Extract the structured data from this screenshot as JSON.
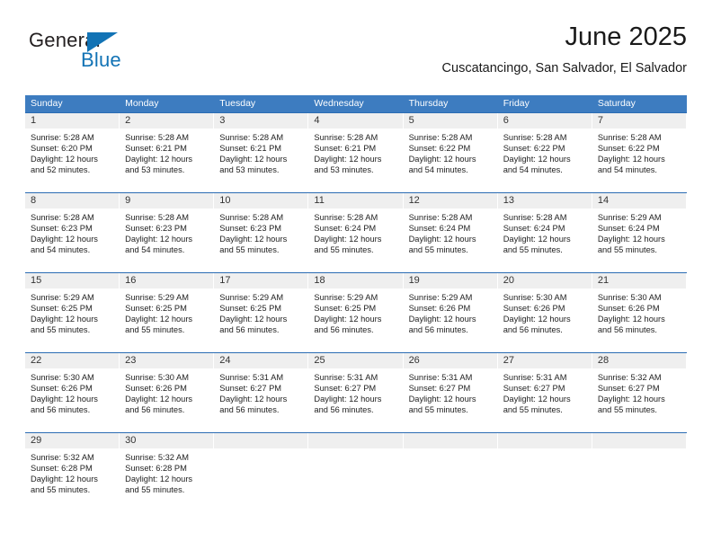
{
  "brand": {
    "name_part1": "General",
    "name_part2": "Blue",
    "flag_icon": "blue-triangle-flag-icon",
    "accent_color": "#1273b5"
  },
  "header": {
    "title": "June 2025",
    "subtitle": "Cuscatancingo, San Salvador, El Salvador"
  },
  "theme": {
    "header_blue": "#3d7cc0",
    "row_border_blue": "#2b6cb3",
    "daynum_band_gray": "#efefef"
  },
  "weekdays": [
    "Sunday",
    "Monday",
    "Tuesday",
    "Wednesday",
    "Thursday",
    "Friday",
    "Saturday"
  ],
  "weeks": [
    [
      {
        "day": "1",
        "sunrise": "Sunrise: 5:28 AM",
        "sunset": "Sunset: 6:20 PM",
        "daylight1": "Daylight: 12 hours",
        "daylight2": "and 52 minutes."
      },
      {
        "day": "2",
        "sunrise": "Sunrise: 5:28 AM",
        "sunset": "Sunset: 6:21 PM",
        "daylight1": "Daylight: 12 hours",
        "daylight2": "and 53 minutes."
      },
      {
        "day": "3",
        "sunrise": "Sunrise: 5:28 AM",
        "sunset": "Sunset: 6:21 PM",
        "daylight1": "Daylight: 12 hours",
        "daylight2": "and 53 minutes."
      },
      {
        "day": "4",
        "sunrise": "Sunrise: 5:28 AM",
        "sunset": "Sunset: 6:21 PM",
        "daylight1": "Daylight: 12 hours",
        "daylight2": "and 53 minutes."
      },
      {
        "day": "5",
        "sunrise": "Sunrise: 5:28 AM",
        "sunset": "Sunset: 6:22 PM",
        "daylight1": "Daylight: 12 hours",
        "daylight2": "and 54 minutes."
      },
      {
        "day": "6",
        "sunrise": "Sunrise: 5:28 AM",
        "sunset": "Sunset: 6:22 PM",
        "daylight1": "Daylight: 12 hours",
        "daylight2": "and 54 minutes."
      },
      {
        "day": "7",
        "sunrise": "Sunrise: 5:28 AM",
        "sunset": "Sunset: 6:22 PM",
        "daylight1": "Daylight: 12 hours",
        "daylight2": "and 54 minutes."
      }
    ],
    [
      {
        "day": "8",
        "sunrise": "Sunrise: 5:28 AM",
        "sunset": "Sunset: 6:23 PM",
        "daylight1": "Daylight: 12 hours",
        "daylight2": "and 54 minutes."
      },
      {
        "day": "9",
        "sunrise": "Sunrise: 5:28 AM",
        "sunset": "Sunset: 6:23 PM",
        "daylight1": "Daylight: 12 hours",
        "daylight2": "and 54 minutes."
      },
      {
        "day": "10",
        "sunrise": "Sunrise: 5:28 AM",
        "sunset": "Sunset: 6:23 PM",
        "daylight1": "Daylight: 12 hours",
        "daylight2": "and 55 minutes."
      },
      {
        "day": "11",
        "sunrise": "Sunrise: 5:28 AM",
        "sunset": "Sunset: 6:24 PM",
        "daylight1": "Daylight: 12 hours",
        "daylight2": "and 55 minutes."
      },
      {
        "day": "12",
        "sunrise": "Sunrise: 5:28 AM",
        "sunset": "Sunset: 6:24 PM",
        "daylight1": "Daylight: 12 hours",
        "daylight2": "and 55 minutes."
      },
      {
        "day": "13",
        "sunrise": "Sunrise: 5:28 AM",
        "sunset": "Sunset: 6:24 PM",
        "daylight1": "Daylight: 12 hours",
        "daylight2": "and 55 minutes."
      },
      {
        "day": "14",
        "sunrise": "Sunrise: 5:29 AM",
        "sunset": "Sunset: 6:24 PM",
        "daylight1": "Daylight: 12 hours",
        "daylight2": "and 55 minutes."
      }
    ],
    [
      {
        "day": "15",
        "sunrise": "Sunrise: 5:29 AM",
        "sunset": "Sunset: 6:25 PM",
        "daylight1": "Daylight: 12 hours",
        "daylight2": "and 55 minutes."
      },
      {
        "day": "16",
        "sunrise": "Sunrise: 5:29 AM",
        "sunset": "Sunset: 6:25 PM",
        "daylight1": "Daylight: 12 hours",
        "daylight2": "and 55 minutes."
      },
      {
        "day": "17",
        "sunrise": "Sunrise: 5:29 AM",
        "sunset": "Sunset: 6:25 PM",
        "daylight1": "Daylight: 12 hours",
        "daylight2": "and 56 minutes."
      },
      {
        "day": "18",
        "sunrise": "Sunrise: 5:29 AM",
        "sunset": "Sunset: 6:25 PM",
        "daylight1": "Daylight: 12 hours",
        "daylight2": "and 56 minutes."
      },
      {
        "day": "19",
        "sunrise": "Sunrise: 5:29 AM",
        "sunset": "Sunset: 6:26 PM",
        "daylight1": "Daylight: 12 hours",
        "daylight2": "and 56 minutes."
      },
      {
        "day": "20",
        "sunrise": "Sunrise: 5:30 AM",
        "sunset": "Sunset: 6:26 PM",
        "daylight1": "Daylight: 12 hours",
        "daylight2": "and 56 minutes."
      },
      {
        "day": "21",
        "sunrise": "Sunrise: 5:30 AM",
        "sunset": "Sunset: 6:26 PM",
        "daylight1": "Daylight: 12 hours",
        "daylight2": "and 56 minutes."
      }
    ],
    [
      {
        "day": "22",
        "sunrise": "Sunrise: 5:30 AM",
        "sunset": "Sunset: 6:26 PM",
        "daylight1": "Daylight: 12 hours",
        "daylight2": "and 56 minutes."
      },
      {
        "day": "23",
        "sunrise": "Sunrise: 5:30 AM",
        "sunset": "Sunset: 6:26 PM",
        "daylight1": "Daylight: 12 hours",
        "daylight2": "and 56 minutes."
      },
      {
        "day": "24",
        "sunrise": "Sunrise: 5:31 AM",
        "sunset": "Sunset: 6:27 PM",
        "daylight1": "Daylight: 12 hours",
        "daylight2": "and 56 minutes."
      },
      {
        "day": "25",
        "sunrise": "Sunrise: 5:31 AM",
        "sunset": "Sunset: 6:27 PM",
        "daylight1": "Daylight: 12 hours",
        "daylight2": "and 56 minutes."
      },
      {
        "day": "26",
        "sunrise": "Sunrise: 5:31 AM",
        "sunset": "Sunset: 6:27 PM",
        "daylight1": "Daylight: 12 hours",
        "daylight2": "and 55 minutes."
      },
      {
        "day": "27",
        "sunrise": "Sunrise: 5:31 AM",
        "sunset": "Sunset: 6:27 PM",
        "daylight1": "Daylight: 12 hours",
        "daylight2": "and 55 minutes."
      },
      {
        "day": "28",
        "sunrise": "Sunrise: 5:32 AM",
        "sunset": "Sunset: 6:27 PM",
        "daylight1": "Daylight: 12 hours",
        "daylight2": "and 55 minutes."
      }
    ],
    [
      {
        "day": "29",
        "sunrise": "Sunrise: 5:32 AM",
        "sunset": "Sunset: 6:28 PM",
        "daylight1": "Daylight: 12 hours",
        "daylight2": "and 55 minutes."
      },
      {
        "day": "30",
        "sunrise": "Sunrise: 5:32 AM",
        "sunset": "Sunset: 6:28 PM",
        "daylight1": "Daylight: 12 hours",
        "daylight2": "and 55 minutes."
      },
      {
        "day": "",
        "sunrise": "",
        "sunset": "",
        "daylight1": "",
        "daylight2": ""
      },
      {
        "day": "",
        "sunrise": "",
        "sunset": "",
        "daylight1": "",
        "daylight2": ""
      },
      {
        "day": "",
        "sunrise": "",
        "sunset": "",
        "daylight1": "",
        "daylight2": ""
      },
      {
        "day": "",
        "sunrise": "",
        "sunset": "",
        "daylight1": "",
        "daylight2": ""
      },
      {
        "day": "",
        "sunrise": "",
        "sunset": "",
        "daylight1": "",
        "daylight2": ""
      }
    ]
  ]
}
